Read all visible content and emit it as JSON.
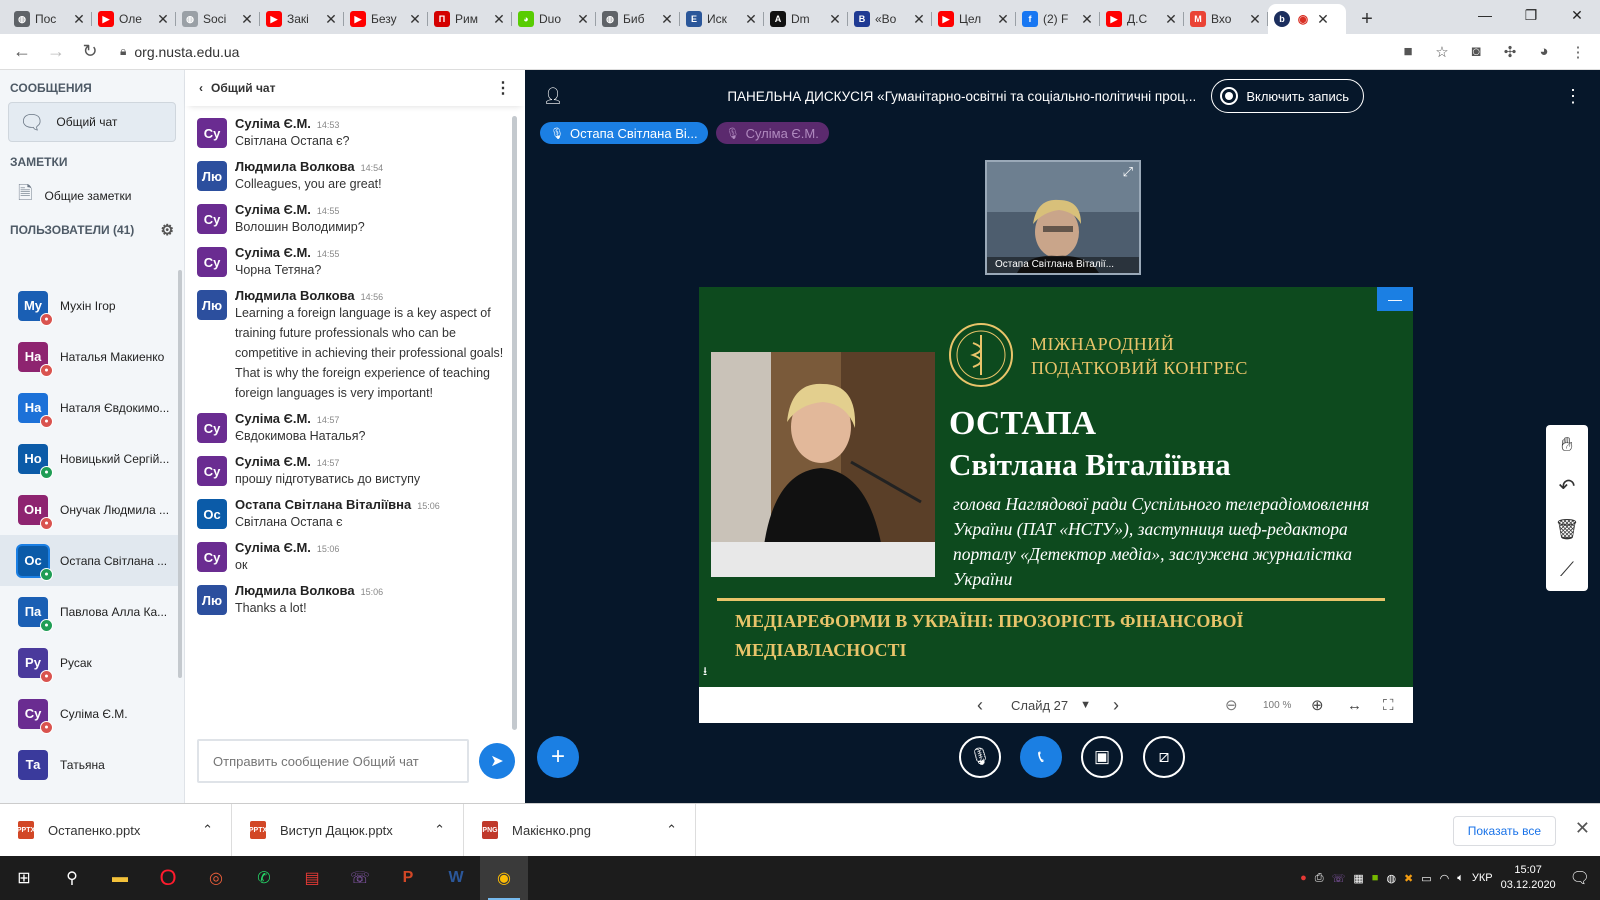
{
  "browser": {
    "tabs": [
      {
        "title": "Пос",
        "fav_color": "#5f6368",
        "fav_glyph": "◍"
      },
      {
        "title": "Оле",
        "fav_color": "#ff0000",
        "fav_glyph": "▶"
      },
      {
        "title": "Soci",
        "fav_color": "#9aa0a6",
        "fav_glyph": "◍"
      },
      {
        "title": "Закі",
        "fav_color": "#ff0000",
        "fav_glyph": "▶"
      },
      {
        "title": "Безу",
        "fav_color": "#ff0000",
        "fav_glyph": "▶"
      },
      {
        "title": "Рим",
        "fav_color": "#d40000",
        "fav_glyph": "П"
      },
      {
        "title": "Duo",
        "fav_color": "#58cc02",
        "fav_glyph": "◕"
      },
      {
        "title": "Биб",
        "fav_color": "#5f6368",
        "fav_glyph": "◍"
      },
      {
        "title": "Иск",
        "fav_color": "#2b579a",
        "fav_glyph": "E"
      },
      {
        "title": "Dm",
        "fav_color": "#111111",
        "fav_glyph": "A"
      },
      {
        "title": "«Во",
        "fav_color": "#1f3a93",
        "fav_glyph": "B"
      },
      {
        "title": "Цел",
        "fav_color": "#ff0000",
        "fav_glyph": "▶"
      },
      {
        "title": "(2) F",
        "fav_color": "#1877f2",
        "fav_glyph": "f"
      },
      {
        "title": "Д.С",
        "fav_color": "#ff0000",
        "fav_glyph": "▶"
      },
      {
        "title": "Вхо",
        "fav_color": "#ea4335",
        "fav_glyph": "M"
      }
    ],
    "url": "org.nusta.edu.ua"
  },
  "sidebar": {
    "messages_title": "СООБЩЕНИЯ",
    "public_chat_label": "Общий чат",
    "notes_title": "ЗАМЕТКИ",
    "shared_notes_label": "Общие заметки",
    "users_title": "ПОЛЬЗОВАТЕЛИ (41)",
    "users": [
      {
        "initials": "Му",
        "name": "Мухін Ігор",
        "color": "#1a5fb4",
        "mic": "muted"
      },
      {
        "initials": "На",
        "name": "Наталья Макиенко",
        "color": "#8e2470",
        "mic": "muted"
      },
      {
        "initials": "На",
        "name": "Наталя Євдокимо...",
        "color": "#1c71d8",
        "mic": "muted"
      },
      {
        "initials": "Но",
        "name": "Новицький Сергій...",
        "color": "#0b5ba8",
        "mic": "on"
      },
      {
        "initials": "Он",
        "name": "Онучак Людмила ...",
        "color": "#8e2470",
        "mic": "muted"
      },
      {
        "initials": "Ос",
        "name": "Остапа Світлана ...",
        "color": "#0b5ba8",
        "mic": "on",
        "selected": true
      },
      {
        "initials": "Па",
        "name": "Павлова Алла Ка...",
        "color": "#1a5fb4",
        "mic": "on"
      },
      {
        "initials": "Ру",
        "name": "Русак",
        "color": "#4a3a9c",
        "mic": "muted"
      },
      {
        "initials": "Су",
        "name": "Суліма Є.М.",
        "color": "#6a2c91",
        "mic": "muted"
      },
      {
        "initials": "Та",
        "name": "Татьяна",
        "color": "#3a3a9c",
        "mic": "none"
      }
    ]
  },
  "chat": {
    "title": "Общий чат",
    "messages": [
      {
        "initials": "Су",
        "color": "#6a2c91",
        "author": "Суліма Є.М.",
        "time": "14:53",
        "text": "Світлана Остапа є?"
      },
      {
        "initials": "Лю",
        "color": "#2c4f9e",
        "author": "Людмила Волкова",
        "time": "14:54",
        "text": "Colleagues, you are great!"
      },
      {
        "initials": "Су",
        "color": "#6a2c91",
        "author": "Суліма Є.М.",
        "time": "14:55",
        "text": "Волошин Володимир?"
      },
      {
        "initials": "Су",
        "color": "#6a2c91",
        "author": "Суліма Є.М.",
        "time": "14:55",
        "text": "Чорна Тетяна?"
      },
      {
        "initials": "Лю",
        "color": "#2c4f9e",
        "author": "Людмила Волкова",
        "time": "14:56",
        "text": "Learning a foreign language is a key aspect of training future professionals who can be competitive in achieving their professional goals! That is why the foreign experience of teaching foreign languages is very important!"
      },
      {
        "initials": "Су",
        "color": "#6a2c91",
        "author": "Суліма Є.М.",
        "time": "14:57",
        "text": "Євдокимова Наталья?"
      },
      {
        "initials": "Су",
        "color": "#6a2c91",
        "author": "Суліма Є.М.",
        "time": "14:57",
        "text": "прошу підготуватись до виступу"
      },
      {
        "initials": "Ос",
        "color": "#0b5ba8",
        "author": "Остапа Світлана Віталіївна",
        "time": "15:06",
        "text": "Світлана Остапа є"
      },
      {
        "initials": "Су",
        "color": "#6a2c91",
        "author": "Суліма Є.М.",
        "time": "15:06",
        "text": "ок"
      },
      {
        "initials": "Лю",
        "color": "#2c4f9e",
        "author": "Людмила Волкова",
        "time": "15:06",
        "text": "Thanks a lot!"
      }
    ],
    "input_placeholder": "Отправить сообщение Общий чат"
  },
  "meeting": {
    "title": "ПАНЕЛЬНА ДИСКУСІЯ «Гуманітарно-освітні та соціально-політичні проц...",
    "record_label": "Включить запись",
    "talkers": [
      {
        "name": "Остапа Світлана Ві...",
        "color": "#1b7fe3",
        "active": true
      },
      {
        "name": "Суліма Є.М.",
        "color": "#5b2a6e",
        "active": false
      }
    ],
    "webcam_name": "Остапа Світлана Віталії...",
    "slide": {
      "congress_line1": "МІЖНАРОДНИЙ",
      "congress_line2": "ПОДАТКОВИЙ КОНГРЕС",
      "speaker_surname": "ОСТАПА",
      "speaker_name": "Світлана Віталіївна",
      "speaker_desc": "голова Наглядової ради Суспільного телерадіомовлення України (ПАТ «НСТУ»), заступниця шеф-редактора порталу «Детектор медіа», заслужена журналістка України",
      "topic": "МЕДІАРЕФОРМИ В УКРАЇНІ: ПРОЗОРІСТЬ ФІНАНСОВОЇ МЕДІАВЛАСНОСТІ"
    },
    "slide_label": "Слайд 27",
    "zoom": "100 %"
  },
  "downloads": {
    "items": [
      {
        "name": "Остапенко.pptx",
        "type": "pptx",
        "color": "#d24726"
      },
      {
        "name": "Виступ Дацюк.pptx",
        "type": "pptx",
        "color": "#d24726"
      },
      {
        "name": "Макієнко.png",
        "type": "png",
        "color": "#c0392b"
      }
    ],
    "show_all": "Показать все"
  },
  "taskbar": {
    "lang": "УКР",
    "time": "15:07",
    "date": "03.12.2020"
  }
}
